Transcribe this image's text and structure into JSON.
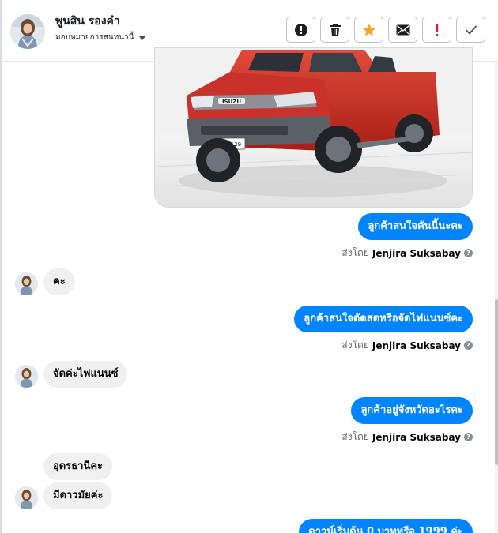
{
  "header": {
    "name": "พูนสิน รองคำ",
    "assign_label": "มอบหมายการสนทนานี้"
  },
  "actions": [
    {
      "name": "mark-spam",
      "icon": "alert-circle-icon"
    },
    {
      "name": "delete",
      "icon": "trash-icon"
    },
    {
      "name": "star",
      "icon": "star-icon"
    },
    {
      "name": "mark-unread",
      "icon": "mail-icon"
    },
    {
      "name": "mark-important",
      "icon": "exclamation-icon"
    },
    {
      "name": "done",
      "icon": "check-icon"
    }
  ],
  "colors": {
    "outgoing_bubble": "#0084ff",
    "incoming_bubble": "#f0f0f0",
    "star": "#f5a623",
    "important": "#e41e3f"
  },
  "car_photo": {
    "brand_badge": "ISUZU",
    "plate": "ฎง 4129"
  },
  "sent_by_prefix": "ส่งโดย",
  "messages": [
    {
      "direction": "out",
      "text": "ลูกค้าสนใจคันนี้นะคะ",
      "sent_by": "Jenjira Suksabay"
    },
    {
      "direction": "in",
      "text": "คะ"
    },
    {
      "direction": "out",
      "text": "ลูกค้าสนใจตัดสดหรือจัดไฟแนนซ์คะ",
      "sent_by": "Jenjira Suksabay"
    },
    {
      "direction": "in",
      "text": "จัดค่ะไฟแนนซ์"
    },
    {
      "direction": "out",
      "text": "ลูกค้าอยู่จังหวัดอะไรคะ",
      "sent_by": "Jenjira Suksabay"
    },
    {
      "direction": "in",
      "text": "อุดรธานีคะ"
    },
    {
      "direction": "in",
      "text": "มีดาวมัยค่ะ"
    },
    {
      "direction": "out",
      "text": "ดาวน์เริ่มต้น 0 บาทหรือ 1999 ค่ะ"
    }
  ]
}
